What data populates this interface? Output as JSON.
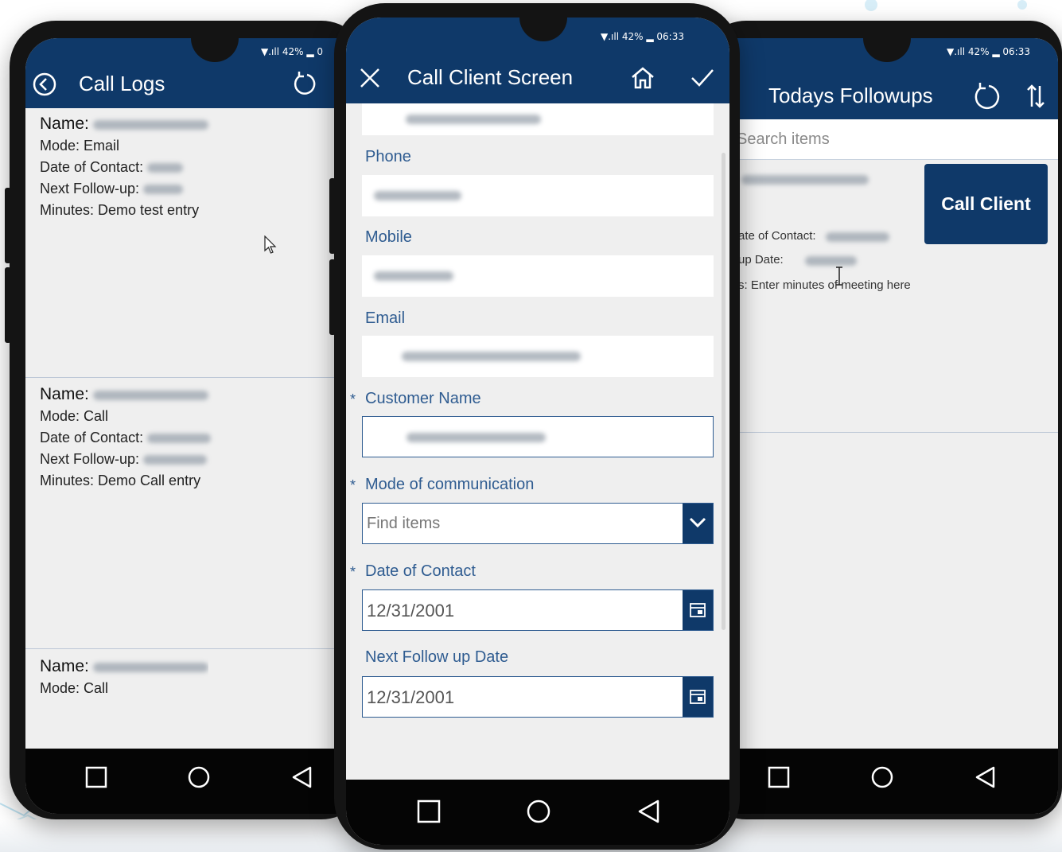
{
  "left_phone": {
    "status": "▼.ıll 42% ▂ 0",
    "title": "Call Logs",
    "logs": [
      {
        "name_label": "Name:",
        "mode": "Mode: Email",
        "date_label": "Date of Contact:",
        "next_label": "Next Follow-up:",
        "minutes": "Minutes: Demo test entry"
      },
      {
        "name_label": "Name:",
        "mode": "Mode: Call",
        "date_label": "Date of Contact:",
        "next_label": "Next Follow-up:",
        "minutes": "Minutes: Demo Call entry"
      },
      {
        "name_label": "Name:",
        "mode": "Mode: Call"
      }
    ],
    "icons": {
      "back": "back-circle-icon",
      "refresh": "refresh-icon"
    }
  },
  "center_phone": {
    "status": "▼.ıll 42% ▂ 06:33",
    "title": "Call Client Screen",
    "labels": {
      "phone": "Phone",
      "mobile": "Mobile",
      "email": "Email",
      "customer": "Customer Name",
      "mode": "Mode of communication",
      "date_contact": "Date of Contact",
      "next_follow": "Next Follow up Date"
    },
    "required_mark": "*",
    "mode_placeholder": "Find items",
    "date_contact_value": "12/31/2001",
    "next_follow_value": "12/31/2001"
  },
  "right_phone": {
    "status": "▼.ıll 42% ▂ 06:33",
    "title": "Todays Followups",
    "search_placeholder": "Search items",
    "row_contact": "ate of Contact:",
    "row_up": "up Date:",
    "row_minutes": "s: Enter minutes of meeting here",
    "call_button": "Call Client"
  },
  "colors": {
    "accent": "#0f3969",
    "label": "#2f5c91"
  }
}
